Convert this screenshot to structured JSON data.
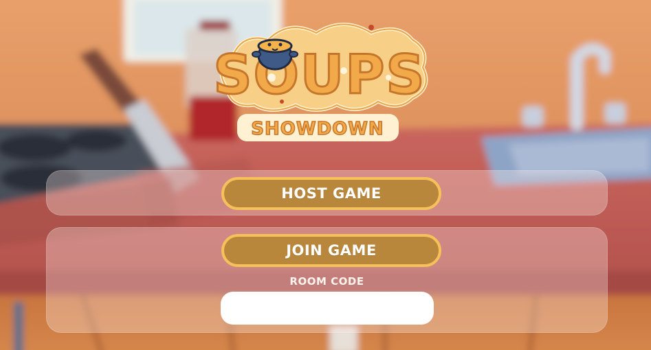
{
  "logo": {
    "title": "SOUPS",
    "subtitle": "SHOWDOWN",
    "mascot_icon": "soup-pot-icon"
  },
  "menu": {
    "host_label": "HOST GAME",
    "join_label": "JOIN GAME",
    "room_code_label": "ROOM CODE",
    "room_code_value": "",
    "room_code_placeholder": ""
  },
  "colors": {
    "button_fill": "#b8873b",
    "button_border": "#f6c15a",
    "panel_tint": "#fff0ec",
    "wall": "#e49a66",
    "counter": "#c2625a"
  }
}
